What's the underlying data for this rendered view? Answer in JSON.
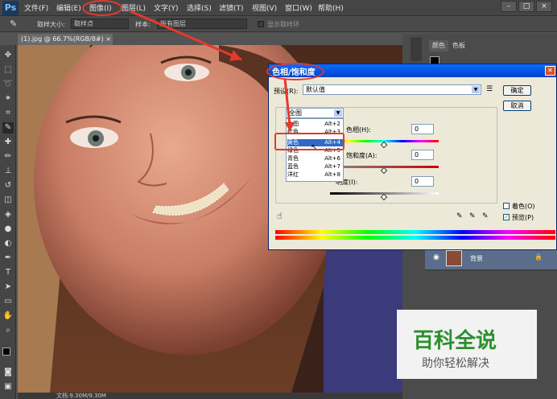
{
  "app": {
    "logo": "Ps"
  },
  "menu": [
    "文件(F)",
    "编辑(E)",
    "图像(I)",
    "图层(L)",
    "文字(Y)",
    "选择(S)",
    "滤镜(T)",
    "视图(V)",
    "窗口(W)",
    "帮助(H)"
  ],
  "window_controls": [
    "–",
    "□",
    "×"
  ],
  "options": {
    "sample_size_label": "取样大小:",
    "sample_size_value": "取样点",
    "sample_label": "样本:",
    "sample_value": "所有图层",
    "show_ring_label": "显示取样环"
  },
  "document": {
    "tab_label": "(1).jpg @ 66.7%(RGB/8#)",
    "status": "文档:9.30M/9.30M"
  },
  "panels": {
    "tabs": [
      "颜色",
      "色板"
    ],
    "layer_name": "背景"
  },
  "dialog": {
    "title": "色相/饱和度",
    "preset_label": "预设(R):",
    "preset_value": "默认值",
    "ok_label": "确定",
    "cancel_label": "取消",
    "channel_value": "全图",
    "hue_label": "色相(H):",
    "hue_value": "0",
    "saturation_label": "饱和度(A):",
    "saturation_value": "0",
    "lightness_label": "明度(I):",
    "lightness_value": "0",
    "colorize_label": "着色(O)",
    "preview_label": "预览(P)"
  },
  "dropdown": {
    "items": [
      {
        "name": "全图",
        "shortcut": "Alt+2"
      },
      {
        "name": "红色",
        "shortcut": "Alt+3"
      },
      {
        "name": "黄色",
        "shortcut": "Alt+4"
      },
      {
        "name": "绿色",
        "shortcut": "Alt+5"
      },
      {
        "name": "青色",
        "shortcut": "Alt+6"
      },
      {
        "name": "蓝色",
        "shortcut": "Alt+7"
      },
      {
        "name": "洋红",
        "shortcut": "Alt+8"
      }
    ],
    "selected": "黄色"
  },
  "watermark": {
    "title": "百科全说",
    "subtitle": "助你轻松解决"
  },
  "colors": {
    "highlight": "#e23a2c",
    "titlebar": "#0a6cff",
    "selection": "#316ac5"
  }
}
